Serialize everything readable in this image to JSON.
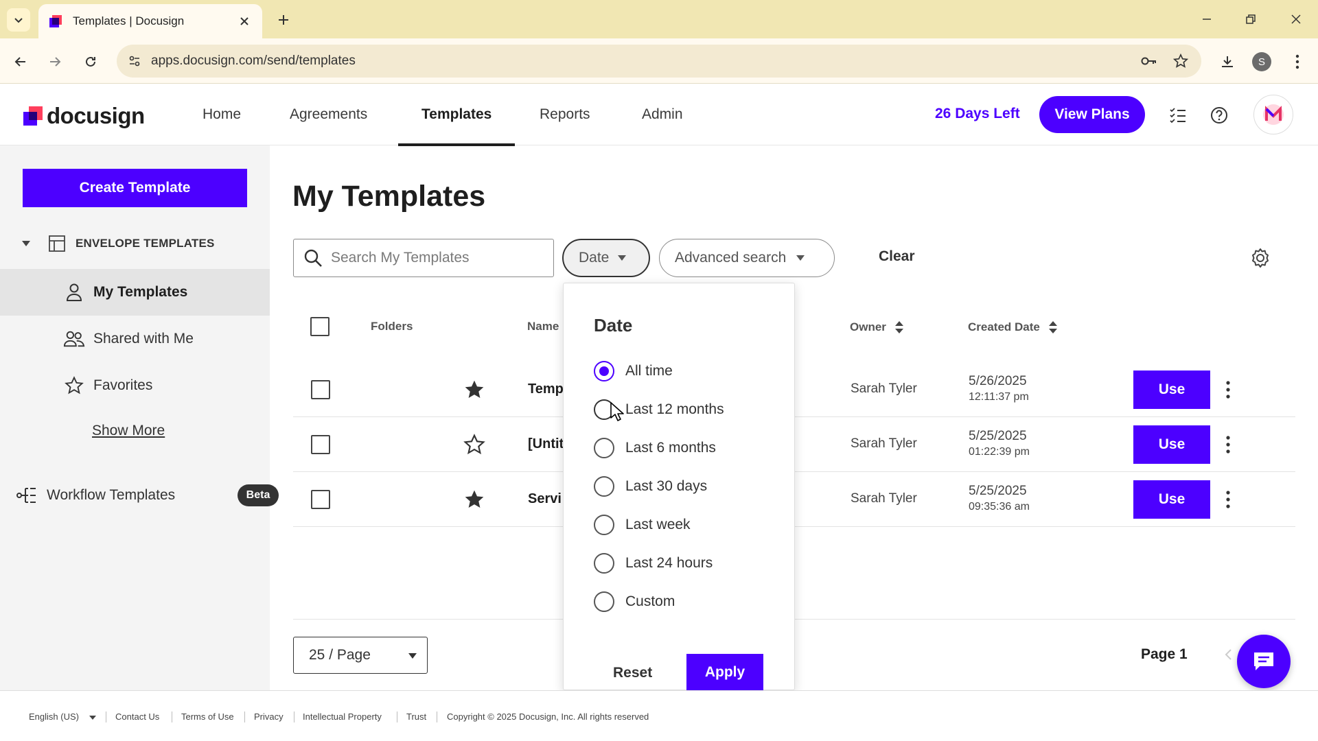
{
  "browser": {
    "tab_title": "Templates | Docusign",
    "url": "apps.docusign.com/send/templates",
    "profile_initial": "S"
  },
  "header": {
    "logo": "docusign",
    "nav": [
      "Home",
      "Agreements",
      "Templates",
      "Reports",
      "Admin"
    ],
    "active_nav": "Templates",
    "days_left": "26 Days Left",
    "view_plans": "View Plans",
    "accent": "#4c00ff"
  },
  "sidebar": {
    "create_label": "Create Template",
    "section": "ENVELOPE TEMPLATES",
    "items": [
      {
        "label": "My Templates",
        "icon": "person-icon"
      },
      {
        "label": "Shared with Me",
        "icon": "people-icon"
      },
      {
        "label": "Favorites",
        "icon": "star-icon"
      }
    ],
    "show_more": "Show More",
    "workflow": "Workflow Templates",
    "beta": "Beta"
  },
  "main": {
    "title": "My Templates",
    "search_placeholder": "Search My Templates",
    "date_filter": "Date",
    "advanced_search": "Advanced search",
    "clear": "Clear",
    "columns": {
      "folders": "Folders",
      "name": "Name",
      "owner": "Owner",
      "created": "Created Date"
    },
    "rows": [
      {
        "starred": true,
        "name": "Templ",
        "owner": "Sarah Tyler",
        "date": "5/26/2025",
        "time": "12:11:37 pm",
        "action": "Use"
      },
      {
        "starred": false,
        "name": "[Untit",
        "owner": "Sarah Tyler",
        "date": "5/25/2025",
        "time": "01:22:39 pm",
        "action": "Use"
      },
      {
        "starred": true,
        "name": "Servi",
        "owner": "Sarah Tyler",
        "date": "5/25/2025",
        "time": "09:35:36 am",
        "action": "Use"
      }
    ],
    "per_page": "25 / Page",
    "page": "Page 1"
  },
  "date_dropdown": {
    "title": "Date",
    "options": [
      "All time",
      "Last 12 months",
      "Last 6 months",
      "Last 30 days",
      "Last week",
      "Last 24 hours",
      "Custom"
    ],
    "selected": "All time",
    "reset": "Reset",
    "apply": "Apply"
  },
  "footer": {
    "language": "English (US)",
    "links": [
      "Contact Us",
      "Terms of Use",
      "Privacy",
      "Intellectual Property",
      "Trust"
    ],
    "copyright": "Copyright © 2025 Docusign, Inc. All rights reserved"
  }
}
